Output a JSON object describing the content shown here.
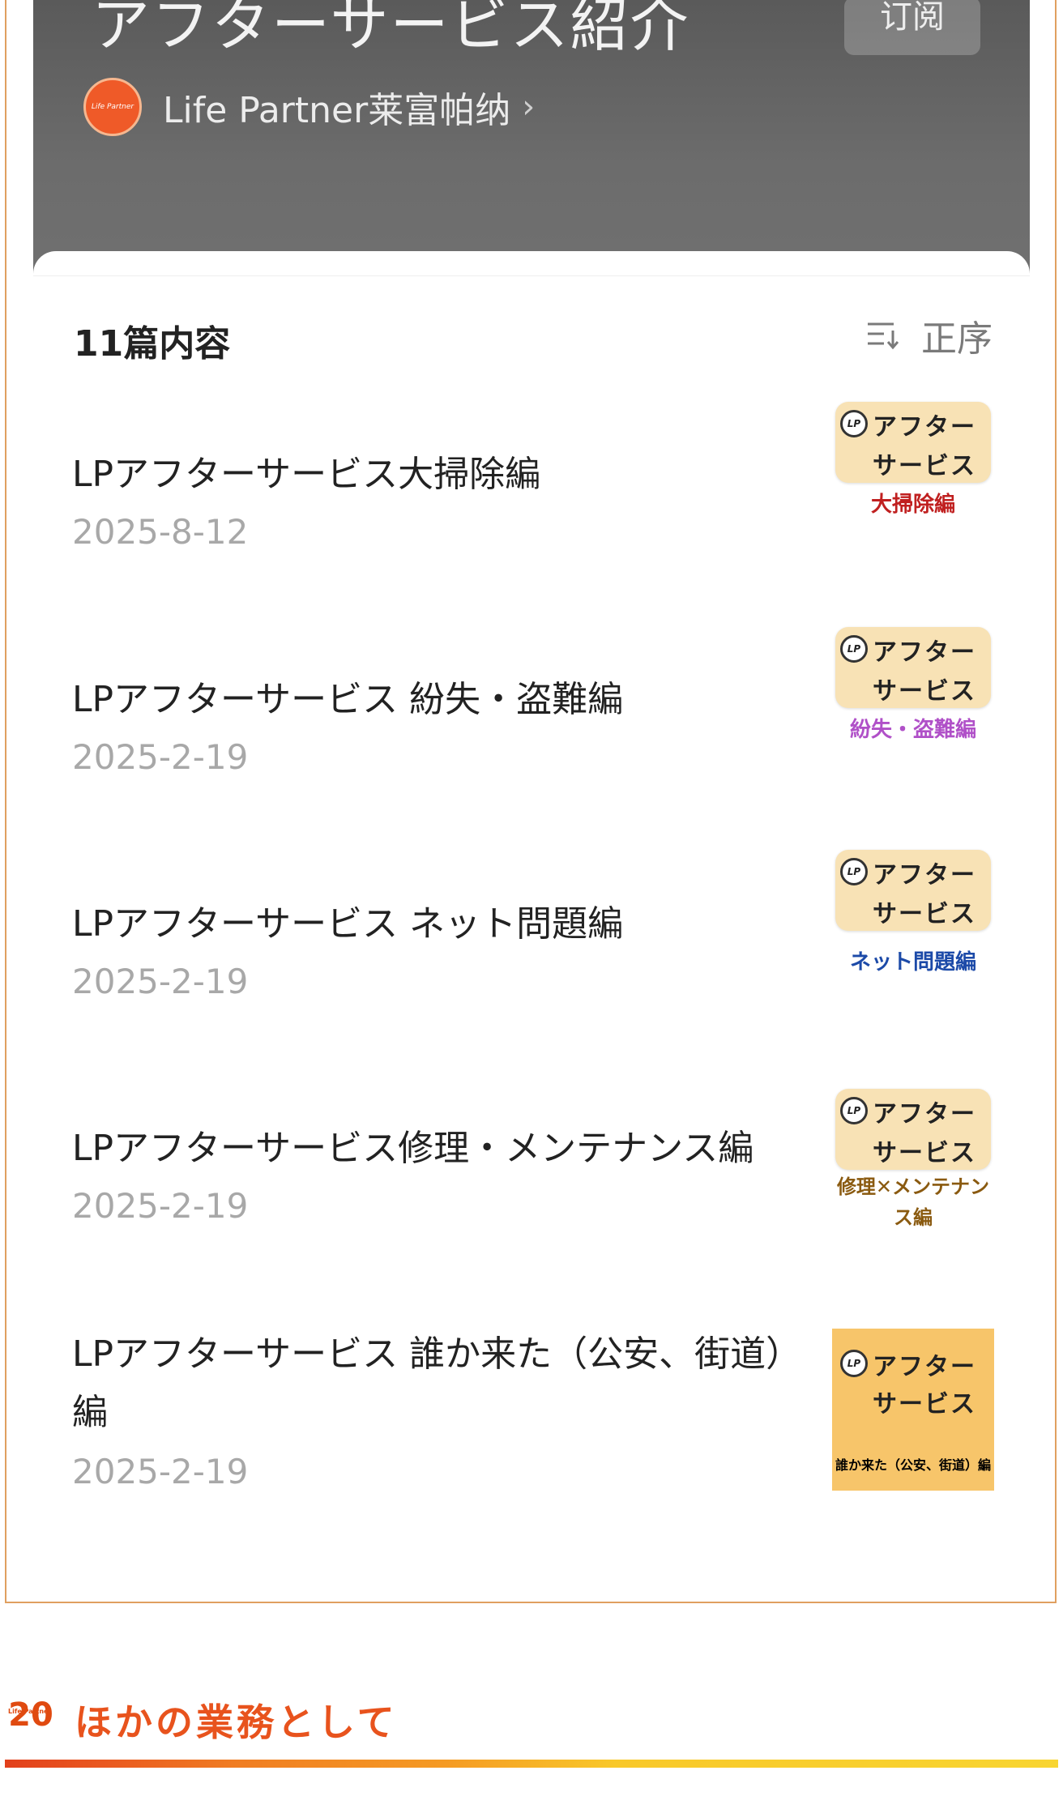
{
  "header": {
    "title": "アフターサービス紹介",
    "subscribe_label": "订阅",
    "channel_name": "Life Partner莱富帕纳",
    "channel_logo_text": "Life Partner"
  },
  "list": {
    "count_label": "11篇内容",
    "sort_label": "正序",
    "items": [
      {
        "title": "LPアフターサービス大掃除編",
        "date": "2025-8-12",
        "thumb": {
          "line1": "アフター",
          "line2": "サービス",
          "category": "大掃除編",
          "category_color": "#c02020"
        }
      },
      {
        "title": "LPアフターサービス 紛失・盗難編",
        "date": "2025-2-19",
        "thumb": {
          "line1": "アフター",
          "line2": "サービス",
          "category": "紛失・盗難編",
          "category_color": "#b050c8"
        }
      },
      {
        "title": "LPアフターサービス ネット問題編",
        "date": "2025-2-19",
        "thumb": {
          "line1": "アフター",
          "line2": "サービス",
          "category": "ネット問題編",
          "category_color": "#1c4aa8"
        }
      },
      {
        "title": "LPアフターサービス修理・メンテナンス編",
        "date": "2025-2-19",
        "thumb": {
          "line1": "アフター",
          "line2": "サービス",
          "category": "修理✕メンテナンス編",
          "category_color": "#8a5a10"
        }
      },
      {
        "title": "LPアフターサービス 誰か来た（公安、街道）編",
        "date": "2025-2-19",
        "thumb": {
          "line1": "アフター",
          "line2": "サービス",
          "category": "誰か来た（公安、街道）編",
          "category_color": "#222222"
        }
      }
    ]
  },
  "footer": {
    "logo_text": "20",
    "logo_small": "Life Partner",
    "title": "ほかの業務として"
  },
  "colors": {
    "accent": "#e8531d",
    "frame_border": "#e0a060"
  }
}
